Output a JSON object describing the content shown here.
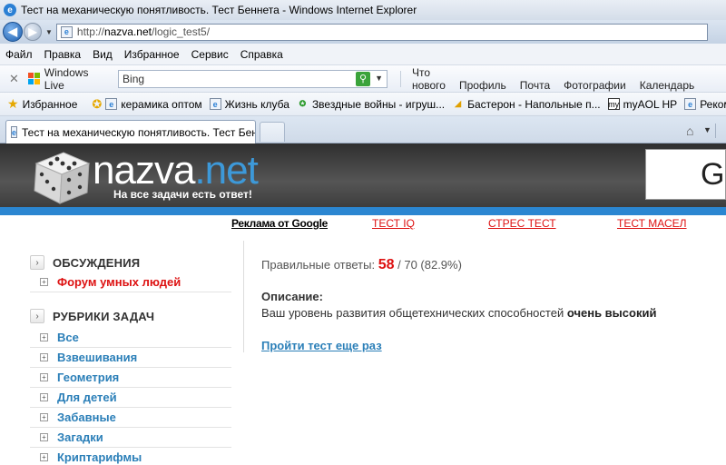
{
  "window": {
    "title": "Тест на механическую понятливость. Тест Беннета - Windows Internet Explorer"
  },
  "address": {
    "url_prefix": "http://",
    "url_host": "nazva.net",
    "url_path": "/logic_test5/"
  },
  "menu": [
    "Файл",
    "Правка",
    "Вид",
    "Избранное",
    "Сервис",
    "Справка"
  ],
  "wl_toolbar": {
    "brand": "Windows Live",
    "search_value": "Bing",
    "links": [
      "Что нового",
      "Профиль",
      "Почта",
      "Фотографии",
      "Календарь"
    ]
  },
  "favorites": {
    "label": "Избранное",
    "items": [
      {
        "label": "керамика оптом",
        "icon": "ie-page-icon"
      },
      {
        "label": "Жизнь клуба",
        "icon": "ie-page-icon"
      },
      {
        "label": "Звездные войны - игруш...",
        "icon": "starwars-icon"
      },
      {
        "label": "Бастерон - Напольные п...",
        "icon": "basteron-icon"
      },
      {
        "label": "myAOL HP",
        "icon": "myaol-icon"
      },
      {
        "label": "Рекомен",
        "icon": "ie-page-icon"
      }
    ]
  },
  "tab": {
    "title": "Тест на механическую понятливость. Тест Бенн..."
  },
  "site": {
    "logo_name": "nazva",
    "logo_dot": ".",
    "logo_tld": "net",
    "slogan": "На все задачи есть ответ!",
    "banner_text": "Gi",
    "ad_google": "Реклама от Google",
    "ad_links": [
      "ТЕСТ IQ",
      "СТРЕС ТЕСТ",
      "ТЕСТ МАСЕЛ"
    ]
  },
  "sidebar": {
    "section1": {
      "title": "ОБСУЖДЕНИЯ",
      "items": [
        "Форум умных людей"
      ]
    },
    "section2": {
      "title": "РУБРИКИ ЗАДАЧ",
      "items": [
        "Все",
        "Взвешивания",
        "Геометрия",
        "Для детей",
        "Забавные",
        "Загадки",
        "Криптарифмы"
      ]
    }
  },
  "result": {
    "label": "Правильные ответы:",
    "correct": "58",
    "total": "/ 70 (82.9%)",
    "desc_heading": "Описание:",
    "desc_text": "Ваш уровень развития общетехнических способностей",
    "desc_level": "очень высокий",
    "retry_link": "Пройти тест еще раз"
  }
}
